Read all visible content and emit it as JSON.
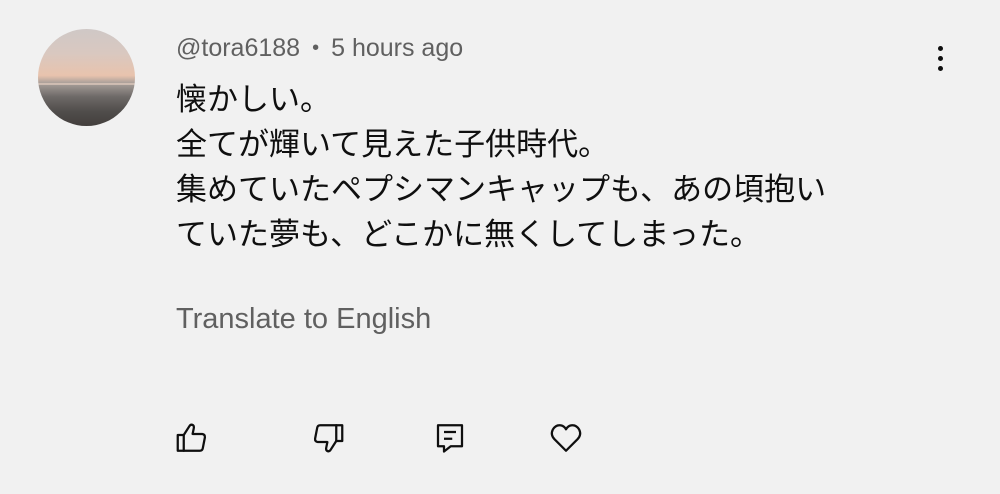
{
  "comment": {
    "author": "@tora6188",
    "separator": "•",
    "timestamp": "5 hours ago",
    "lines": [
      "懐かしい。",
      "全てが輝いて見えた子供時代。",
      "集めていたペプシマンキャップも、あの頃抱い",
      "ていた夢も、どこかに無くしてしまった。"
    ],
    "translate_label": "Translate to English"
  },
  "actions": {
    "like_icon": "thumbs-up-icon",
    "dislike_icon": "thumbs-down-icon",
    "reply_icon": "reply-comment-icon",
    "heart_icon": "heart-icon"
  },
  "menu_icon": "more-vertical-icon"
}
